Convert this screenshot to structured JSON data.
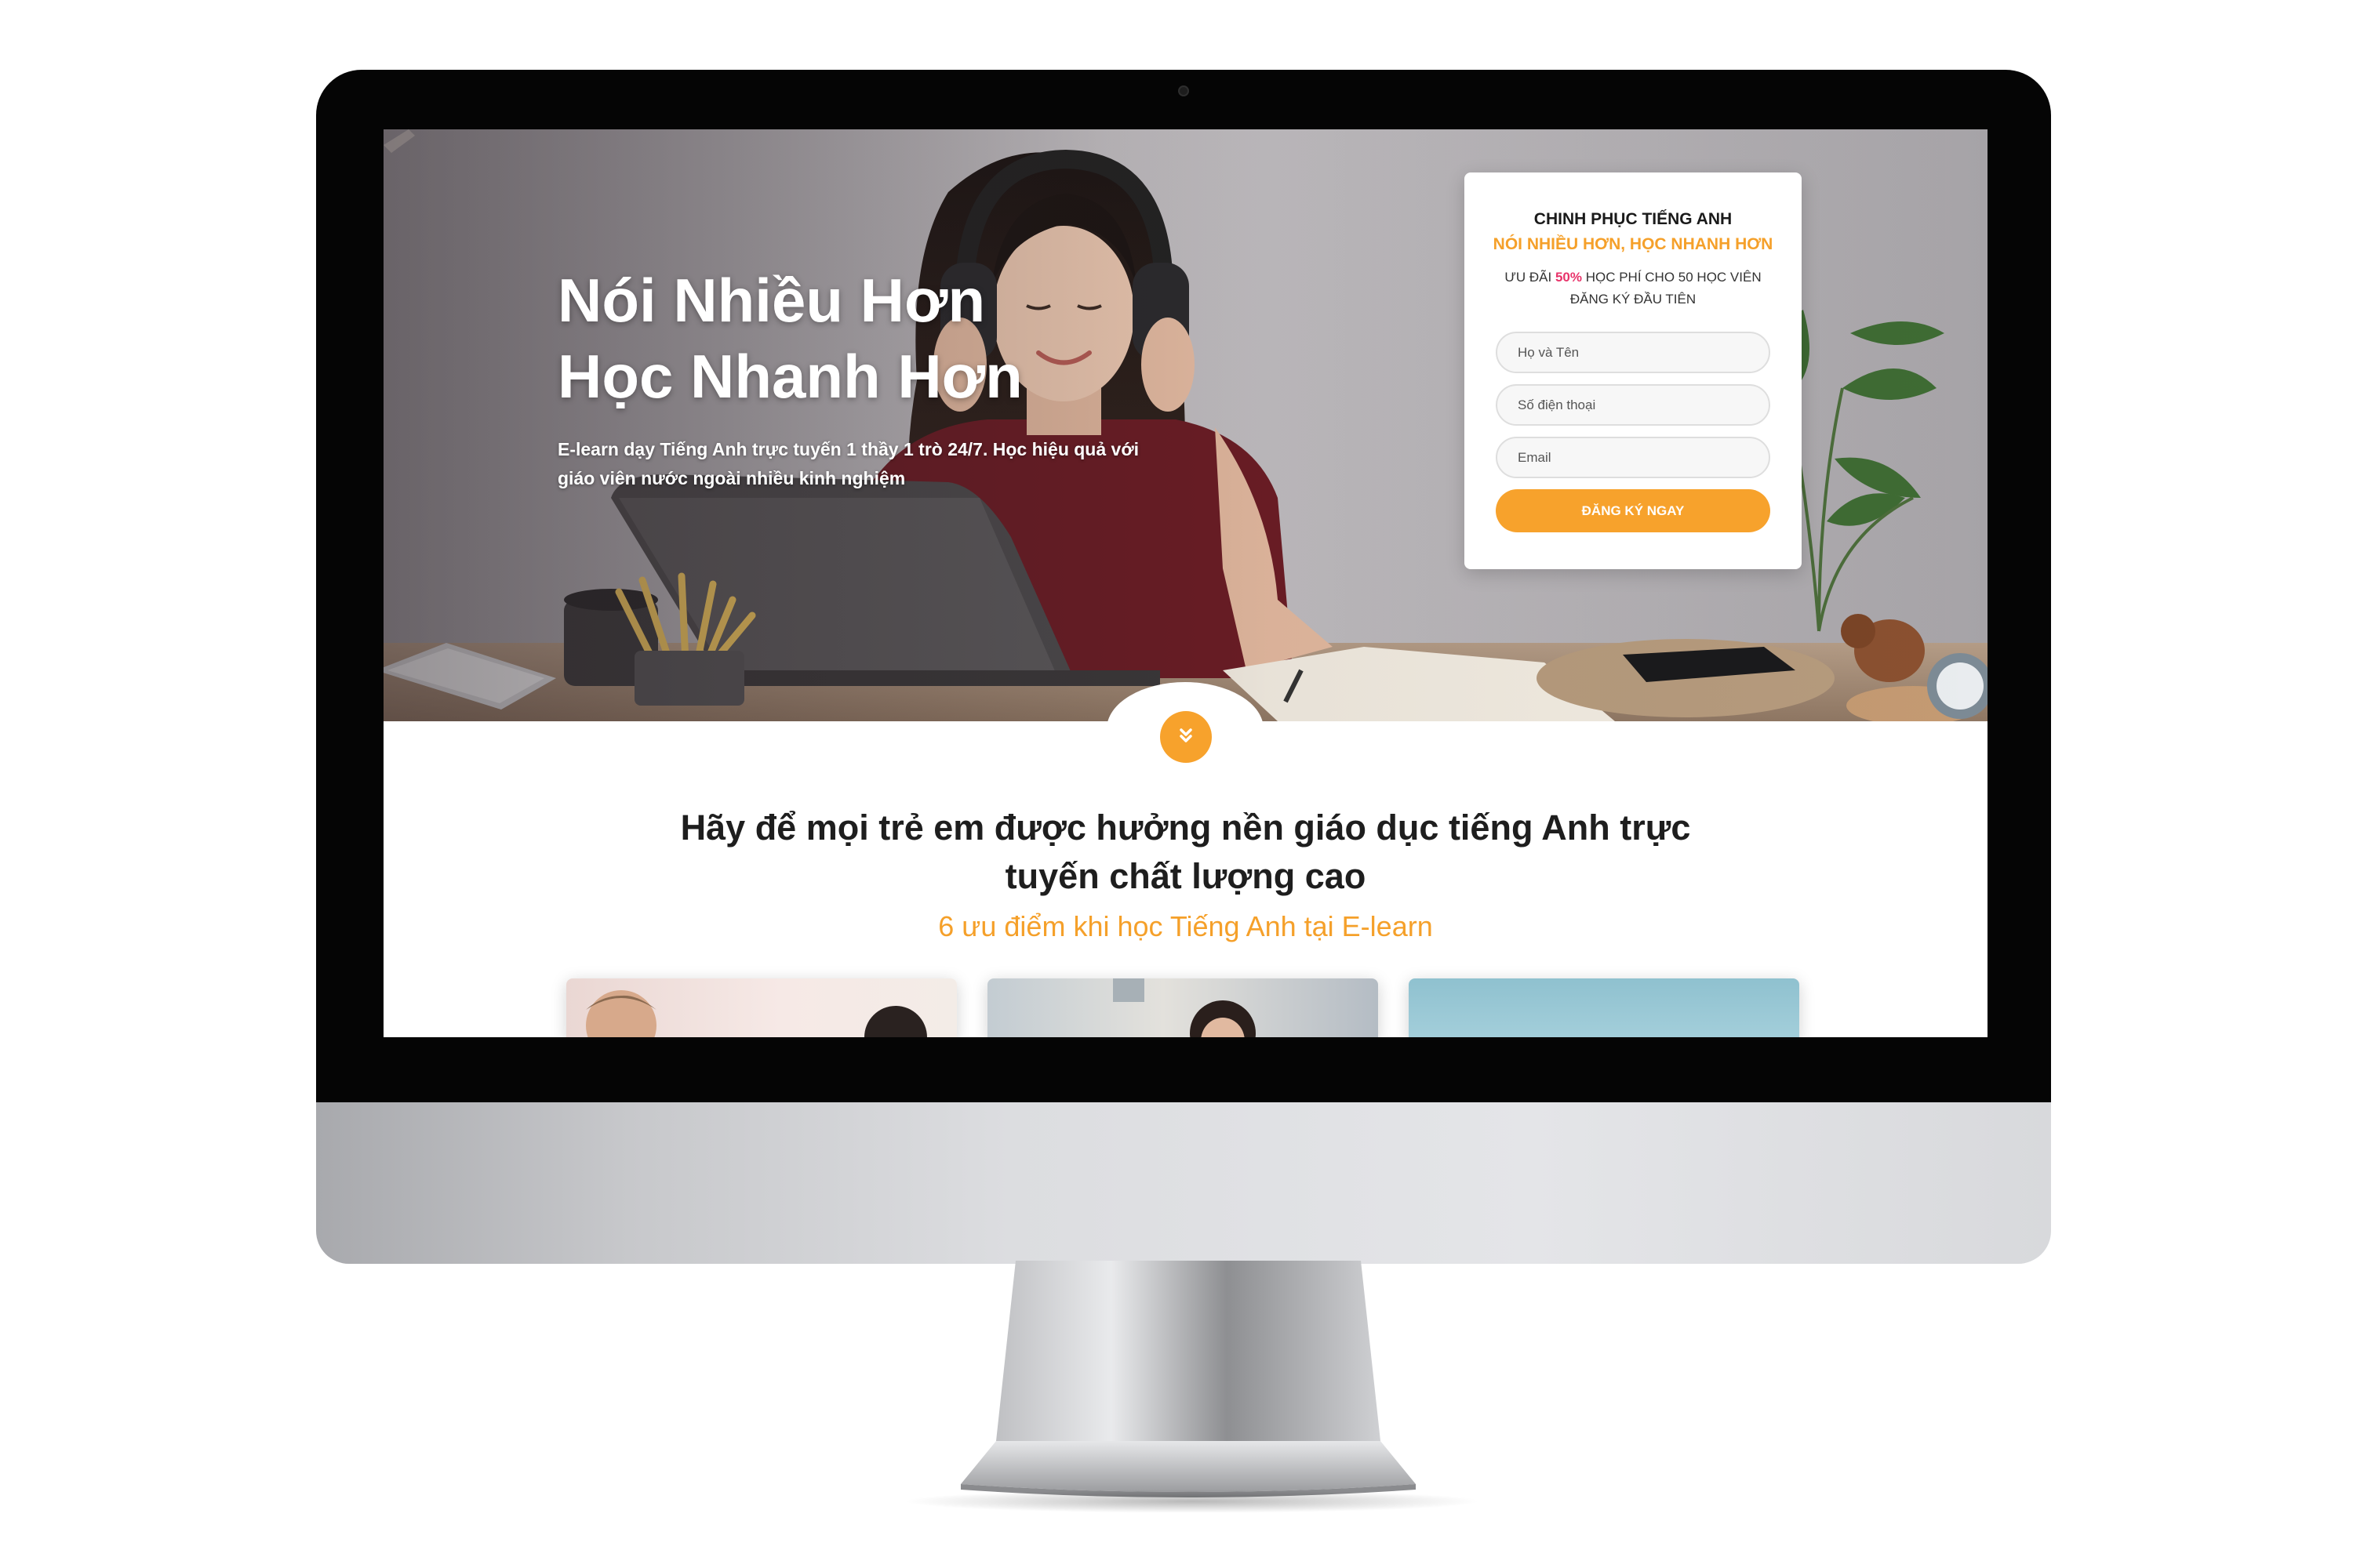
{
  "hero": {
    "title_line1": "Nói Nhiều Hơn",
    "title_line2": "Học Nhanh Hơn",
    "description": "E-learn dạy Tiếng Anh trực tuyến 1 thầy 1 trò 24/7. Học hiệu quả với giáo viên nước ngoài nhiều kinh nghiệm"
  },
  "form": {
    "title": "CHINH PHỤC TIẾNG ANH",
    "subtitle": "NÓI NHIỀU HƠN, HỌC NHANH HƠN",
    "offer_prefix": "ƯU ĐÃI ",
    "offer_highlight": "50%",
    "offer_suffix": " HỌC PHÍ CHO 50 HỌC VIÊN ĐĂNG KÝ ĐẦU TIÊN",
    "name_placeholder": "Họ và Tên",
    "phone_placeholder": "Số điện thoại",
    "email_placeholder": "Email",
    "submit_label": "ĐĂNG KÝ NGAY"
  },
  "intro": {
    "title": "Hãy để mọi trẻ em được hưởng nền giáo dục tiếng Anh trực tuyến chất lượng cao",
    "subtitle": "6 ưu điểm khi học Tiếng Anh tại E-learn"
  },
  "colors": {
    "accent": "#f7a22c",
    "highlight": "#e8336a",
    "heading": "#1e1e1e"
  },
  "icons": {
    "scroll_down": "double-chevron-down-icon"
  }
}
